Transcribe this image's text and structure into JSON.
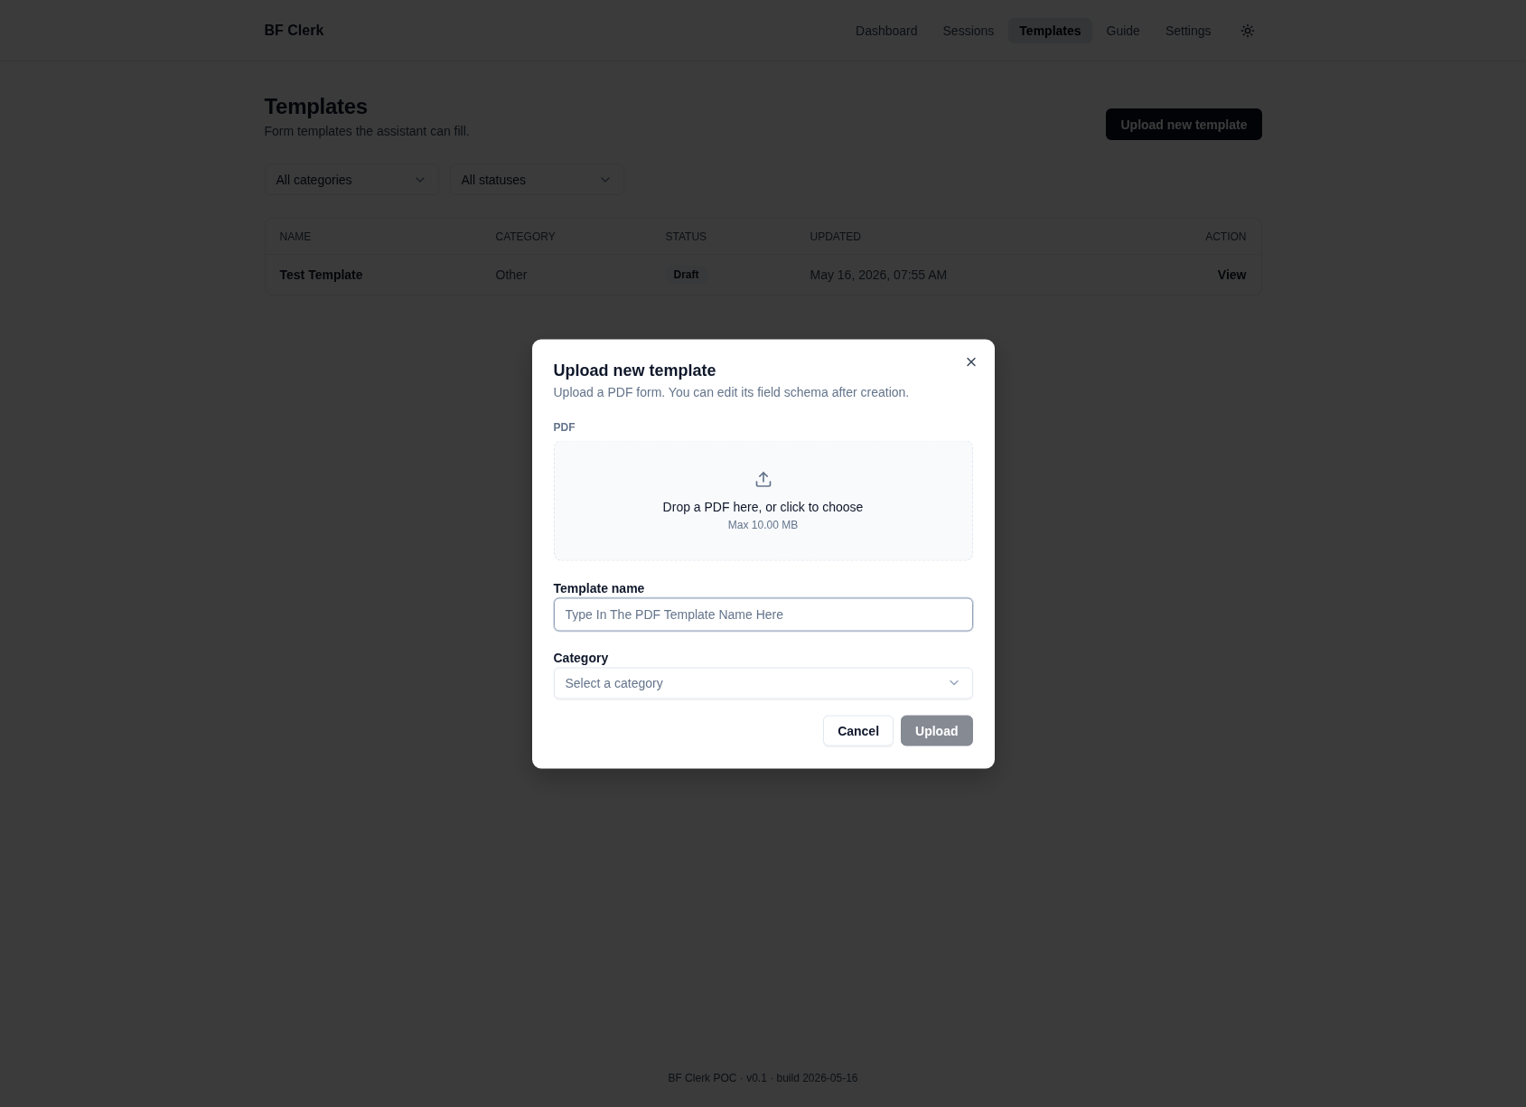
{
  "header": {
    "brand": "BF Clerk",
    "nav": [
      {
        "label": "Dashboard",
        "selected": false
      },
      {
        "label": "Sessions",
        "selected": false
      },
      {
        "label": "Templates",
        "selected": true
      },
      {
        "label": "Guide",
        "selected": false
      },
      {
        "label": "Settings",
        "selected": false
      }
    ]
  },
  "page": {
    "title": "Templates",
    "subtitle": "Form templates the assistant can fill.",
    "primary_action": "Upload new template"
  },
  "filters": [
    {
      "value": "All categories"
    },
    {
      "value": "All statuses"
    }
  ],
  "table": {
    "columns": [
      "NAME",
      "CATEGORY",
      "STATUS",
      "UPDATED",
      "ACTION"
    ],
    "rows": [
      {
        "name": "Test Template",
        "category": "Other",
        "status": "Draft",
        "updated": "May 16, 2026, 07:55 AM",
        "action": "View"
      }
    ]
  },
  "dialog": {
    "title": "Upload new template",
    "description": "Upload a PDF form. You can edit its field schema after creation.",
    "pdf_label": "PDF",
    "dropzone": {
      "text": "Drop a PDF here, or click to choose",
      "limit": "Max 10.00 MB"
    },
    "name_field": {
      "label": "Template name",
      "placeholder": "Type In The PDF Template Name Here",
      "focused": true
    },
    "category_field": {
      "label": "Category",
      "placeholder": "Select a category"
    },
    "buttons": [
      {
        "label": "Cancel",
        "kind": "secondary",
        "disabled": false
      },
      {
        "label": "Upload",
        "kind": "primary",
        "disabled": true
      }
    ]
  },
  "footer": "BF Clerk POC · v0.1 · build 2026-05-16"
}
